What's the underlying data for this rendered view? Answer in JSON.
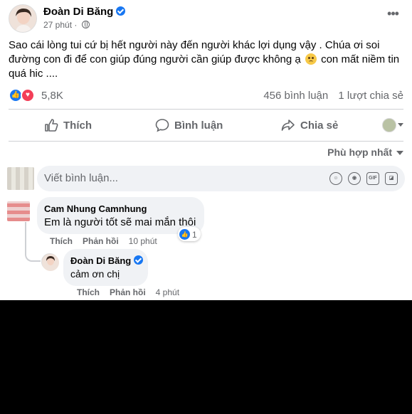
{
  "post": {
    "author": "Đoàn Di Băng",
    "time": "27 phút",
    "text": "Sao cái lòng tui cứ bị hết người này đến người khác lợi dụng vậy . Chúa ơi soi đường con đi để con giúp đúng người cần giúp được không ạ",
    "text_tail": "con mất niềm tin quá hic ....",
    "reaction_count": "5,8K",
    "comment_count": "456 bình luận",
    "share_count": "1 lượt chia sẻ"
  },
  "actions": {
    "like": "Thích",
    "comment": "Bình luận",
    "share": "Chia sẻ"
  },
  "sort": {
    "label": "Phù hợp nhất"
  },
  "composer": {
    "placeholder": "Viết bình luận..."
  },
  "comments": [
    {
      "author": "Cam Nhung Camnhung",
      "text": "Em là người tốt sẽ mai mắn thôi",
      "like": "Thích",
      "reply": "Phản hồi",
      "time": "10 phút",
      "reactions": "1"
    }
  ],
  "reply": {
    "author": "Đoàn Di Băng",
    "text": "cảm ơn chị",
    "like": "Thích",
    "reply": "Phản hồi",
    "time": "4 phút"
  },
  "colors": {
    "brand": "#1877f2",
    "love": "#f33e58",
    "muted": "#65676b"
  }
}
